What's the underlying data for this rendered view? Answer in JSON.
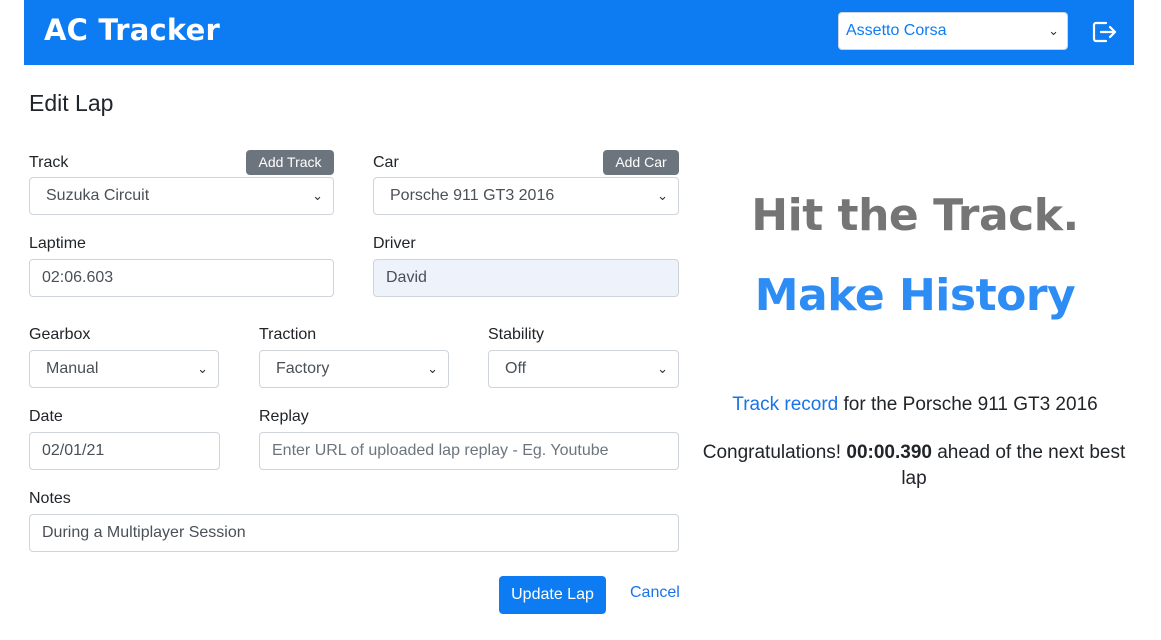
{
  "header": {
    "brand": "AC Tracker",
    "game_select": "Assetto Corsa",
    "logout_icon": "logout-icon"
  },
  "page_title": "Edit Lap",
  "form": {
    "track_label": "Track",
    "add_track": "Add Track",
    "track_value": "Suzuka Circuit",
    "car_label": "Car",
    "add_car": "Add Car",
    "car_value": "Porsche 911 GT3 2016",
    "laptime_label": "Laptime",
    "laptime_value": "02:06.603",
    "driver_label": "Driver",
    "driver_value": "David",
    "gearbox_label": "Gearbox",
    "gearbox_value": "Manual",
    "traction_label": "Traction",
    "traction_value": "Factory",
    "stability_label": "Stability",
    "stability_value": "Off",
    "date_label": "Date",
    "date_value": "02/01/21",
    "replay_label": "Replay",
    "replay_placeholder": "Enter URL of uploaded lap replay - Eg. Youtube",
    "notes_label": "Notes",
    "notes_value": "During a Multiplayer Session",
    "update_button": "Update Lap",
    "cancel_link": "Cancel"
  },
  "hero": {
    "line1": "Hit the Track.",
    "line2": "Make History",
    "record_link": "Track record",
    "record_rest": " for the Porsche 911 GT3 2016",
    "congrats_prefix": "Congratulations! ",
    "congrats_time": "00:00.390",
    "congrats_suffix": " ahead of the next best lap"
  },
  "colors": {
    "primary": "#0d7cf2",
    "secondary": "#6c757d",
    "hero_gray": "#757575",
    "hero_blue": "#2e8cf5"
  }
}
